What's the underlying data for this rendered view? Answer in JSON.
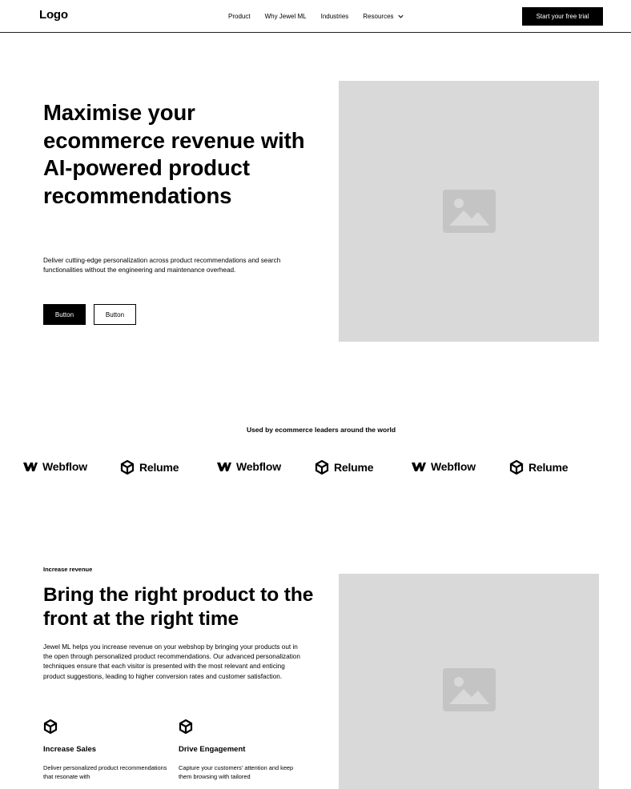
{
  "navbar": {
    "logo": "Logo",
    "links": [
      "Product",
      "Why Jewel ML",
      "Industries"
    ],
    "dropdown_label": "Resources",
    "cta_label": "Start your free trial"
  },
  "hero": {
    "title": "Maximise your ecommerce revenue with AI-powered product recommendations",
    "subtitle": "Deliver cutting-edge personalization across product recommendations and search functionalities without the engineering and maintenance overhead.",
    "primary_button": "Button",
    "secondary_button": "Button",
    "image_icon": "image-placeholder-icon"
  },
  "logos": {
    "heading": "Used by ecommerce leaders around the world",
    "brands": [
      "Webflow",
      "Relume",
      "Webflow",
      "Relume",
      "Webflow",
      "Relume"
    ]
  },
  "section": {
    "eyebrow": "Increase revenue",
    "title": "Bring the right product to the front at the right time",
    "body": "Jewel ML helps you increase revenue on your webshop by bringing your products out in the open through personalized product recommendations. Our advanced personalization techniques ensure that each visitor is presented with the most relevant and enticing product suggestions, leading to higher conversion rates and customer satisfaction.",
    "features": [
      {
        "icon": "cube-icon",
        "title": "Increase Sales",
        "text": "Deliver personalized product recommendations that resonate with"
      },
      {
        "icon": "cube-icon",
        "title": "Drive Engagement",
        "text": "Capture your customers' attention and keep them browsing with tailored"
      }
    ],
    "image_icon": "image-placeholder-icon"
  },
  "colors": {
    "accent": "#000000",
    "placeholder": "#d9d9d9",
    "background": "#ffffff"
  }
}
